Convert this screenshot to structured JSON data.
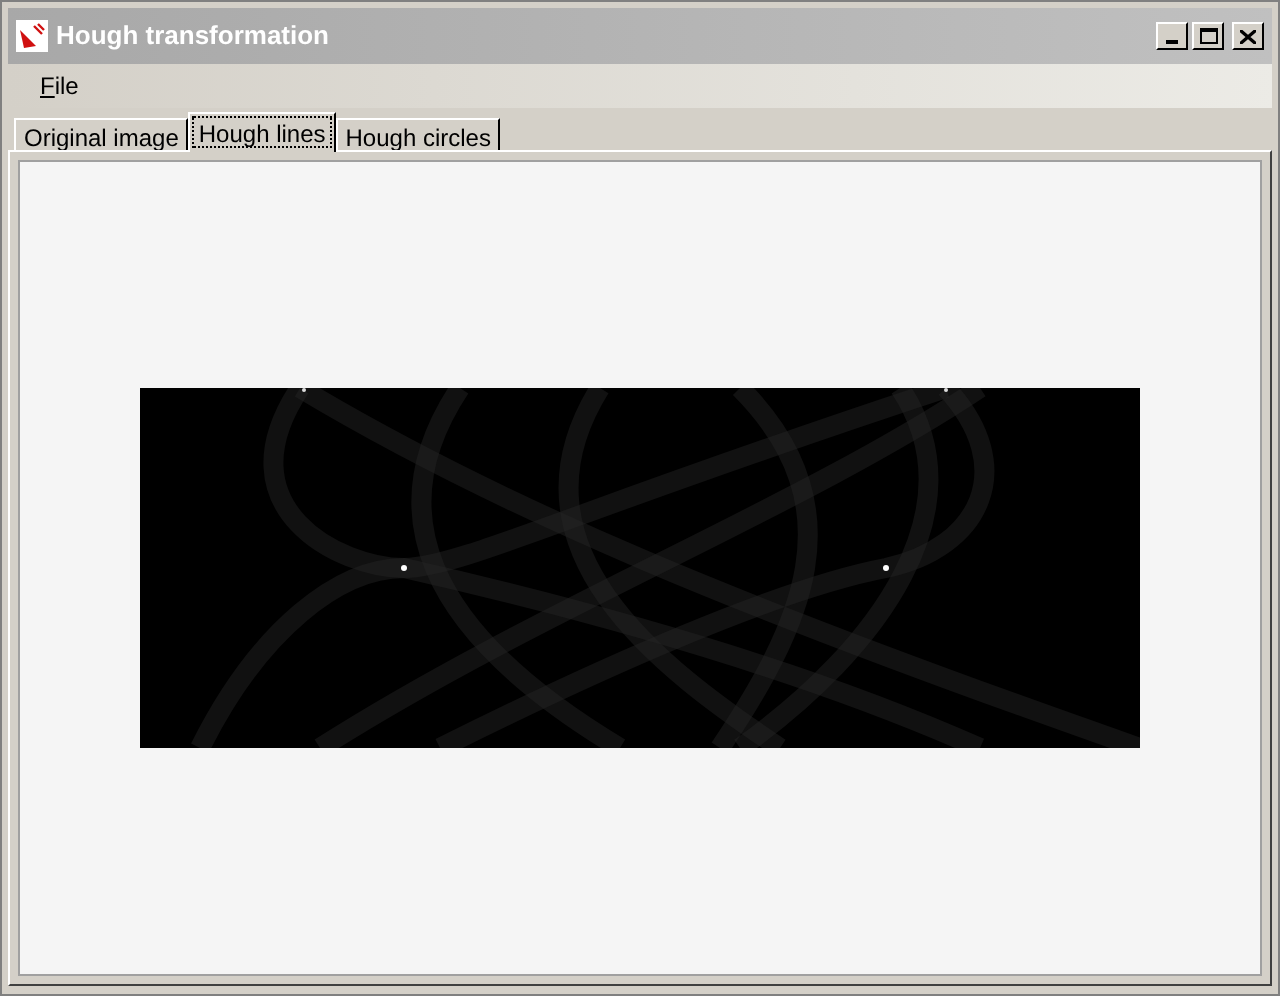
{
  "window": {
    "title": "Hough transformation"
  },
  "menu": [
    {
      "label": "File"
    }
  ],
  "tabs": [
    {
      "label": "Original image",
      "selected": false
    },
    {
      "label": "Hough lines",
      "selected": true
    },
    {
      "label": "Hough circles",
      "selected": false
    }
  ]
}
